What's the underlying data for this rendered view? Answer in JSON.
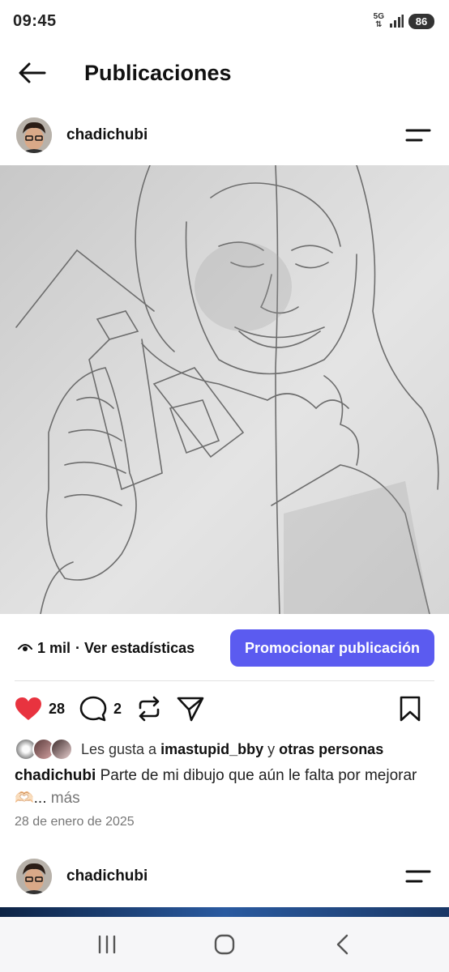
{
  "status": {
    "time": "09:45",
    "network": "5G",
    "battery": "86"
  },
  "header": {
    "title": "Publicaciones"
  },
  "post": {
    "username": "chadichubi",
    "views": "1 mil",
    "stats_link": "· Ver estadísticas",
    "promote_label": "Promocionar publicación",
    "like_count": "28",
    "comment_count": "2",
    "likes_prefix": "Les gusta a",
    "likes_user": "imastupid_bby",
    "likes_conj": "y",
    "likes_suffix": "otras personas",
    "caption_user": "chadichubi",
    "caption_text": "Parte de mi dibujo que aún le falta por mejorar 🫶🏻...",
    "caption_more": "más",
    "date": "28 de enero de 2025"
  },
  "next_post": {
    "username": "chadichubi"
  },
  "colors": {
    "accent": "#5b5bf0",
    "heart": "#e8333f"
  },
  "icons": [
    "back-arrow-icon",
    "menu-icon",
    "heart-icon",
    "comment-icon",
    "repost-icon",
    "share-icon",
    "bookmark-icon",
    "eye-icon",
    "recents-icon",
    "home-icon",
    "back-nav-icon"
  ]
}
